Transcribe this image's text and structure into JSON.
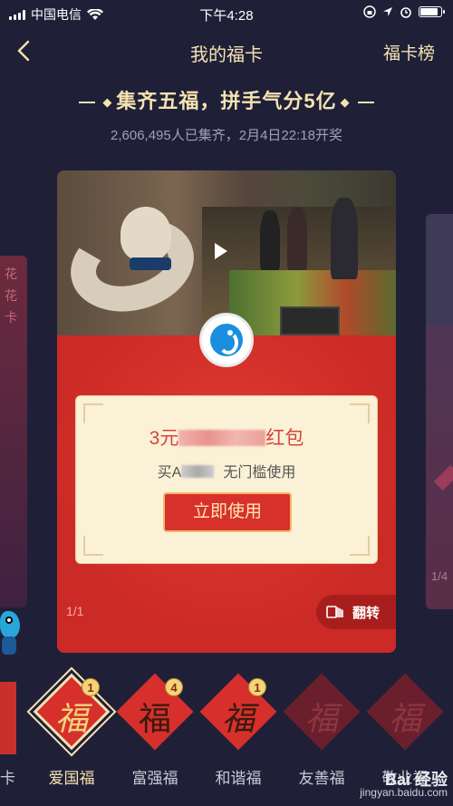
{
  "status_bar": {
    "carrier": "中国电信",
    "time": "下午4:28"
  },
  "nav": {
    "title": "我的福卡",
    "rank_label": "福卡榜"
  },
  "headline": {
    "text": "集齐五福，拼手气分5亿"
  },
  "subline": {
    "text": "2,606,495人已集齐，2月4日22:18开奖"
  },
  "side_left": {
    "text": "花花卡"
  },
  "side_right": {
    "page": "1/4"
  },
  "card": {
    "coupon_title_prefix": "3元",
    "coupon_title_suffix": "红包",
    "coupon_desc_prefix": "买A",
    "coupon_desc_suffix": "无门槛使用",
    "use_button": "立即使用",
    "page_indicator": "1/1",
    "flip_label": "翻转"
  },
  "fu_cards": [
    {
      "char": "福",
      "label": "爱国福",
      "count": "1",
      "selected": true,
      "style": "art"
    },
    {
      "char": "福",
      "label": "富强福",
      "count": "4",
      "selected": false,
      "style": "normal"
    },
    {
      "char": "福",
      "label": "和谐福",
      "count": "1",
      "selected": false,
      "style": "normal"
    },
    {
      "char": "福",
      "label": "友善福",
      "count": "",
      "selected": false,
      "style": "dim"
    },
    {
      "char": "福",
      "label": "敬业福",
      "count": "",
      "selected": false,
      "style": "dim"
    }
  ],
  "left_edge_label": "卡",
  "watermark": {
    "line1": "Bai 经验",
    "line2": "jingyan.baidu.com"
  },
  "colors": {
    "background": "#1f2038",
    "accent_gold": "#f5e2b0",
    "card_red": "#d9312d"
  }
}
